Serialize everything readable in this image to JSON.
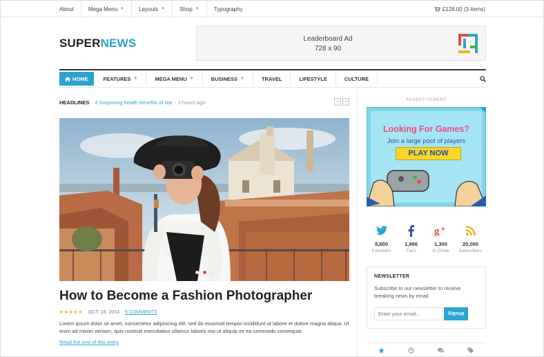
{
  "topbar": {
    "items": [
      {
        "label": "About",
        "caret": false
      },
      {
        "label": "Mega Menu",
        "caret": true
      },
      {
        "label": "Layouts",
        "caret": true
      },
      {
        "label": "Shop",
        "caret": true
      },
      {
        "label": "Typography",
        "caret": false
      }
    ],
    "cart_text": "£128.00 (3 items)"
  },
  "brand": {
    "part1": "SUPER",
    "part2": "NEWS",
    "color_accent": "#2aa4cf"
  },
  "leaderboard": {
    "line1": "Leaderboard Ad",
    "line2": "728 x 90"
  },
  "nav": {
    "home": "HOME",
    "items": [
      "FEATURES",
      "MEGA MENU",
      "BUSINESS",
      "TRAVEL",
      "LIFESTYLE",
      "CULTURE"
    ]
  },
  "headlines": {
    "label": "HEADLINES",
    "link": "4 Surprising health benefits of tea",
    "time": "- 3 hours ago"
  },
  "slider": {
    "active_index": 1,
    "count": 3
  },
  "article": {
    "title": "How to Become a Fashion Photographer",
    "stars": "★★★★★",
    "date": "OCT. 16, 2014",
    "comments": "5 COMMENTS",
    "excerpt": "Lorem ipsum dolor sit amet, consectetur adipisicing elit, sed do eiusmod tempor incididunt ut labore et dolore magna aliqua. Ut enim ad minim veniam, quis nostrud exercitation ullamco laboris nisi ut aliquip ex ea commodo consequat.",
    "read_more": "Read the rest of this entry"
  },
  "sidebar": {
    "ad_label": "ADVERTISEMENT",
    "ad": {
      "line1": "Looking For Games?",
      "line2": "Join a large pool of players",
      "cta": "PLAY NOW"
    },
    "social": [
      {
        "icon": "twitter-icon",
        "count": "5,600",
        "label": "Followers",
        "color": "#2aa4cf"
      },
      {
        "icon": "facebook-icon",
        "count": "1,986",
        "label": "Fans",
        "color": "#3b5998"
      },
      {
        "icon": "google-plus-icon",
        "count": "1,300",
        "label": "In Circle",
        "color": "#dd4b39"
      },
      {
        "icon": "rss-icon",
        "count": "20,000",
        "label": "Subscribers",
        "color": "#f2b01e"
      }
    ],
    "newsletter": {
      "title": "NEWSLETTER",
      "description": "Subscribe to our newsletter to receive breaking news by email.",
      "placeholder": "Enter your email...",
      "button": "Signup"
    }
  }
}
